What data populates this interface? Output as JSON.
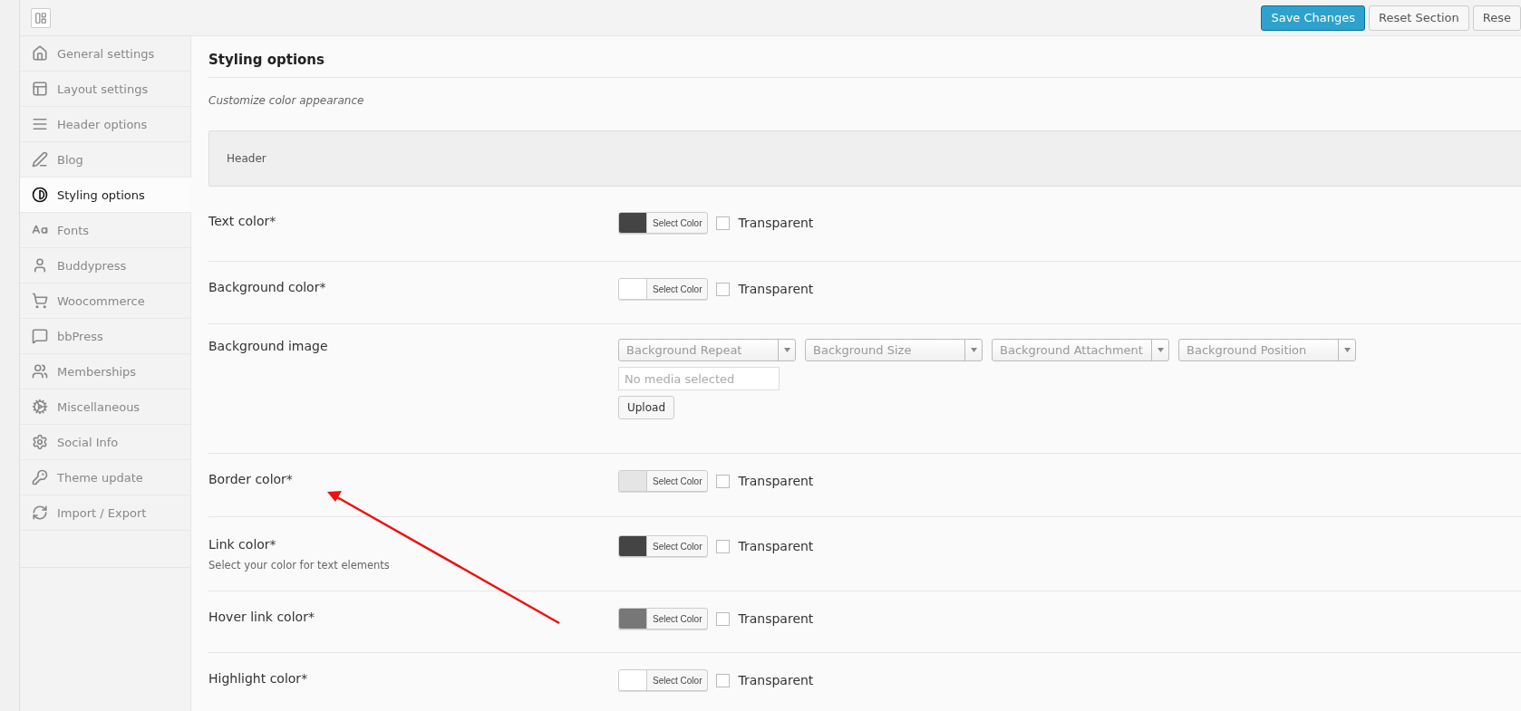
{
  "toolbar": {
    "buttons": [
      {
        "label": "Save Changes",
        "kind": "primary"
      },
      {
        "label": "Reset Section",
        "kind": "secondary"
      },
      {
        "label": "Rese",
        "kind": "secondary"
      }
    ]
  },
  "sidebar": {
    "items": [
      {
        "label": "General settings",
        "selected": false
      },
      {
        "label": "Layout settings",
        "selected": false
      },
      {
        "label": "Header options",
        "selected": false
      },
      {
        "label": "Blog",
        "selected": false
      },
      {
        "label": "Styling options",
        "selected": true
      },
      {
        "label": "Fonts",
        "selected": false
      },
      {
        "label": "Buddypress",
        "selected": false
      },
      {
        "label": "Woocommerce",
        "selected": false
      },
      {
        "label": "bbPress",
        "selected": false
      },
      {
        "label": "Memberships",
        "selected": false
      },
      {
        "label": "Miscellaneous",
        "selected": false
      },
      {
        "label": "Social Info",
        "selected": false
      },
      {
        "label": "Theme update",
        "selected": false
      },
      {
        "label": "Import / Export",
        "selected": false
      }
    ]
  },
  "section": {
    "title": "Styling options",
    "subtitle": "Customize color appearance",
    "group": "Header",
    "rows": [
      {
        "kind": "color",
        "label": "Text color*",
        "button": "Select Color",
        "color": "#444444",
        "transparent": {
          "label": "Transparent",
          "checked": false
        }
      },
      {
        "kind": "color",
        "label": "Background color*",
        "button": "Select Color",
        "color": "#ffffff",
        "transparent": {
          "label": "Transparent",
          "checked": false
        }
      },
      {
        "kind": "image",
        "label": "Background image",
        "selects": [
          {
            "placeholder": "Background Repeat"
          },
          {
            "placeholder": "Background Size"
          },
          {
            "placeholder": "Background Attachment"
          },
          {
            "placeholder": "Background Position"
          }
        ],
        "media": {
          "placeholder": "No media selected"
        },
        "button": "Upload"
      },
      {
        "kind": "color",
        "label": "Border color*",
        "button": "Select Color",
        "color": "#e5e5e5",
        "transparent": {
          "label": "Transparent",
          "checked": false
        }
      },
      {
        "kind": "color",
        "label": "Link color*",
        "description": "Select your color for text elements",
        "button": "Select Color",
        "color": "#444444",
        "transparent": {
          "label": "Transparent",
          "checked": false
        }
      },
      {
        "kind": "color",
        "label": "Hover link color*",
        "button": "Select Color",
        "color": "#777777",
        "transparent": {
          "label": "Transparent",
          "checked": false
        }
      },
      {
        "kind": "color",
        "label": "Highlight color*",
        "button": "Select Color",
        "color": "#ffffff",
        "transparent": {
          "label": "Transparent",
          "checked": false
        }
      }
    ]
  }
}
